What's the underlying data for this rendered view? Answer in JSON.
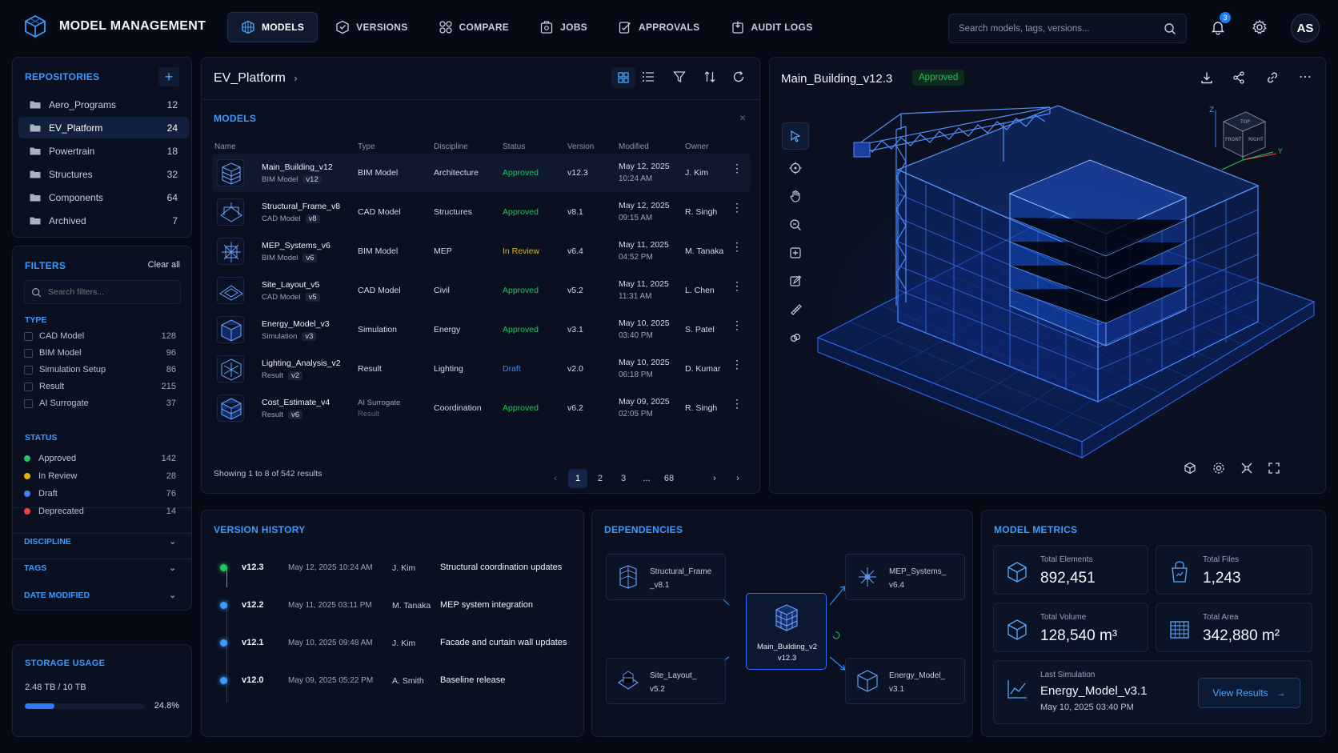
{
  "app": {
    "title": "MODEL MANAGEMENT"
  },
  "nav": [
    {
      "label": "MODELS",
      "icon": "cube-grid-icon"
    },
    {
      "label": "VERSIONS",
      "icon": "version-icon"
    },
    {
      "label": "COMPARE",
      "icon": "compare-icon"
    },
    {
      "label": "JOBS",
      "icon": "jobs-icon"
    },
    {
      "label": "APPROVALS",
      "icon": "approvals-icon"
    },
    {
      "label": "AUDIT LOGS",
      "icon": "audit-icon"
    }
  ],
  "search": {
    "placeholder": "Search models, tags, versions..."
  },
  "notifications": {
    "count": "3"
  },
  "user": {
    "initials": "AS"
  },
  "repositories": {
    "title": "REPOSITORIES",
    "items": [
      {
        "name": "Aero_Programs",
        "count": "12"
      },
      {
        "name": "EV_Platform",
        "count": "24"
      },
      {
        "name": "Powertrain",
        "count": "18"
      },
      {
        "name": "Structures",
        "count": "32"
      },
      {
        "name": "Components",
        "count": "64"
      },
      {
        "name": "Archived",
        "count": "7"
      }
    ]
  },
  "filters": {
    "title": "FILTERS",
    "clear": "Clear all",
    "search_placeholder": "Search filters...",
    "type_title": "TYPE",
    "types": [
      {
        "name": "CAD Model",
        "count": "128"
      },
      {
        "name": "BIM Model",
        "count": "96"
      },
      {
        "name": "Simulation Setup",
        "count": "86"
      },
      {
        "name": "Result",
        "count": "215"
      },
      {
        "name": "AI Surrogate",
        "count": "37"
      }
    ],
    "status_title": "STATUS",
    "statuses": [
      {
        "name": "Approved",
        "count": "142",
        "color": "#22c55e"
      },
      {
        "name": "In Review",
        "count": "28",
        "color": "#eab308"
      },
      {
        "name": "Draft",
        "count": "76",
        "color": "#3b82f6"
      },
      {
        "name": "Deprecated",
        "count": "14",
        "color": "#ef4444"
      }
    ],
    "discipline": "DISCIPLINE",
    "tags": "TAGS",
    "date_modified": "DATE MODIFIED"
  },
  "storage": {
    "title": "STORAGE USAGE",
    "used": "2.48 TB / 10 TB",
    "percent": "24.8%",
    "fraction": 0.248
  },
  "workspace": {
    "breadcrumb": "EV_Platform"
  },
  "models": {
    "title": "MODELS",
    "columns": [
      "Name",
      "Type",
      "Discipline",
      "Status",
      "Version",
      "Modified",
      "Owner"
    ],
    "rows": [
      {
        "name": "Main_Building_v12",
        "sub": "BIM Model",
        "ver_tag": "v12",
        "type": "BIM Model",
        "type2": "",
        "discipline": "Architecture",
        "status": "Approved",
        "status_color": "#22c55e",
        "version": "v12.3",
        "date": "May 12, 2025",
        "time": "10:24 AM",
        "owner": "J. Kim"
      },
      {
        "name": "Structural_Frame_v8",
        "sub": "CAD Model",
        "ver_tag": "v8",
        "type": "CAD Model",
        "type2": "",
        "discipline": "Structures",
        "status": "Approved",
        "status_color": "#22c55e",
        "version": "v8.1",
        "date": "May 12, 2025",
        "time": "09:15 AM",
        "owner": "R. Singh"
      },
      {
        "name": "MEP_Systems_v6",
        "sub": "BIM Model",
        "ver_tag": "v6",
        "type": "BIM Model",
        "type2": "",
        "discipline": "MEP",
        "status": "In Review",
        "status_color": "#eab308",
        "version": "v6.4",
        "date": "May 11, 2025",
        "time": "04:52 PM",
        "owner": "M. Tanaka"
      },
      {
        "name": "Site_Layout_v5",
        "sub": "CAD Model",
        "ver_tag": "v5",
        "type": "CAD Model",
        "type2": "",
        "discipline": "Civil",
        "status": "Approved",
        "status_color": "#22c55e",
        "version": "v5.2",
        "date": "May 11, 2025",
        "time": "11:31 AM",
        "owner": "L. Chen"
      },
      {
        "name": "Energy_Model_v3",
        "sub": "Simulation",
        "ver_tag": "v3",
        "type": "Simulation",
        "type2": "",
        "discipline": "Energy",
        "status": "Approved",
        "status_color": "#22c55e",
        "version": "v3.1",
        "date": "May 10, 2025",
        "time": "03:40 PM",
        "owner": "S. Patel"
      },
      {
        "name": "Lighting_Analysis_v2",
        "sub": "Result",
        "ver_tag": "v2",
        "type": "Result",
        "type2": "",
        "discipline": "Lighting",
        "status": "Draft",
        "status_color": "#3b82f6",
        "version": "v2.0",
        "date": "May 10, 2025",
        "time": "06:18 PM",
        "owner": "D. Kumar"
      },
      {
        "name": "Cost_Estimate_v4",
        "sub": "Result",
        "ver_tag": "v6",
        "type": "AI Surrogate",
        "type2": "Result",
        "discipline": "Coordination",
        "status": "Approved",
        "status_color": "#22c55e",
        "version": "v6.2",
        "date": "May 09, 2025",
        "time": "02:05 PM",
        "owner": "R. Singh"
      }
    ],
    "showing": "Showing 1 to 8 of 542 results",
    "pages": [
      "1",
      "2",
      "3",
      "...",
      "68"
    ]
  },
  "viewer": {
    "title": "Main_Building_v12.3",
    "status": "Approved",
    "axis_z": "Z",
    "axis_y": "Y",
    "cube_top": "TOP",
    "cube_front": "FRONT",
    "cube_right": "RIGHT"
  },
  "version_history": {
    "title": "VERSION HISTORY",
    "items": [
      {
        "version": "v12.3",
        "date": "May 12, 2025 10:24 AM",
        "author": "J. Kim",
        "note": "Structural coordination updates",
        "color": "#22c55e"
      },
      {
        "version": "v12.2",
        "date": "May 11, 2025 03:11 PM",
        "author": "M. Tanaka",
        "note": "MEP system integration",
        "color": "#3b9bff"
      },
      {
        "version": "v12.1",
        "date": "May 10, 2025 09:48 AM",
        "author": "J. Kim",
        "note": "Facade and curtain wall updates",
        "color": "#3b9bff"
      },
      {
        "version": "v12.0",
        "date": "May 09, 2025 05:22 PM",
        "author": "A. Smith",
        "note": "Baseline release",
        "color": "#3b9bff"
      }
    ]
  },
  "dependencies": {
    "title": "DEPENDENCIES",
    "center": {
      "l1": "Main_Building_v2",
      "l2": "v12.3"
    },
    "nodes": [
      {
        "l1": "Structural_Frame",
        "l2": "_v8.1"
      },
      {
        "l1": "MEP_Systems_",
        "l2": "v6.4"
      },
      {
        "l1": "Site_Layout_",
        "l2": "v5.2"
      },
      {
        "l1": "Energy_Model_",
        "l2": "v3.1"
      }
    ]
  },
  "metrics": {
    "title": "MODEL METRICS",
    "total_elements_label": "Total Elements",
    "total_elements": "892,451",
    "total_files_label": "Total Files",
    "total_files": "1,243",
    "total_volume_label": "Total Volume",
    "total_volume": "128,540 m³",
    "total_area_label": "Total Area",
    "total_area": "342,880 m²",
    "last_sim_label": "Last Simulation",
    "last_sim_name": "Energy_Model_v3.1",
    "last_sim_date": "May 10, 2025 03:40 PM",
    "view_results": "View Results"
  }
}
